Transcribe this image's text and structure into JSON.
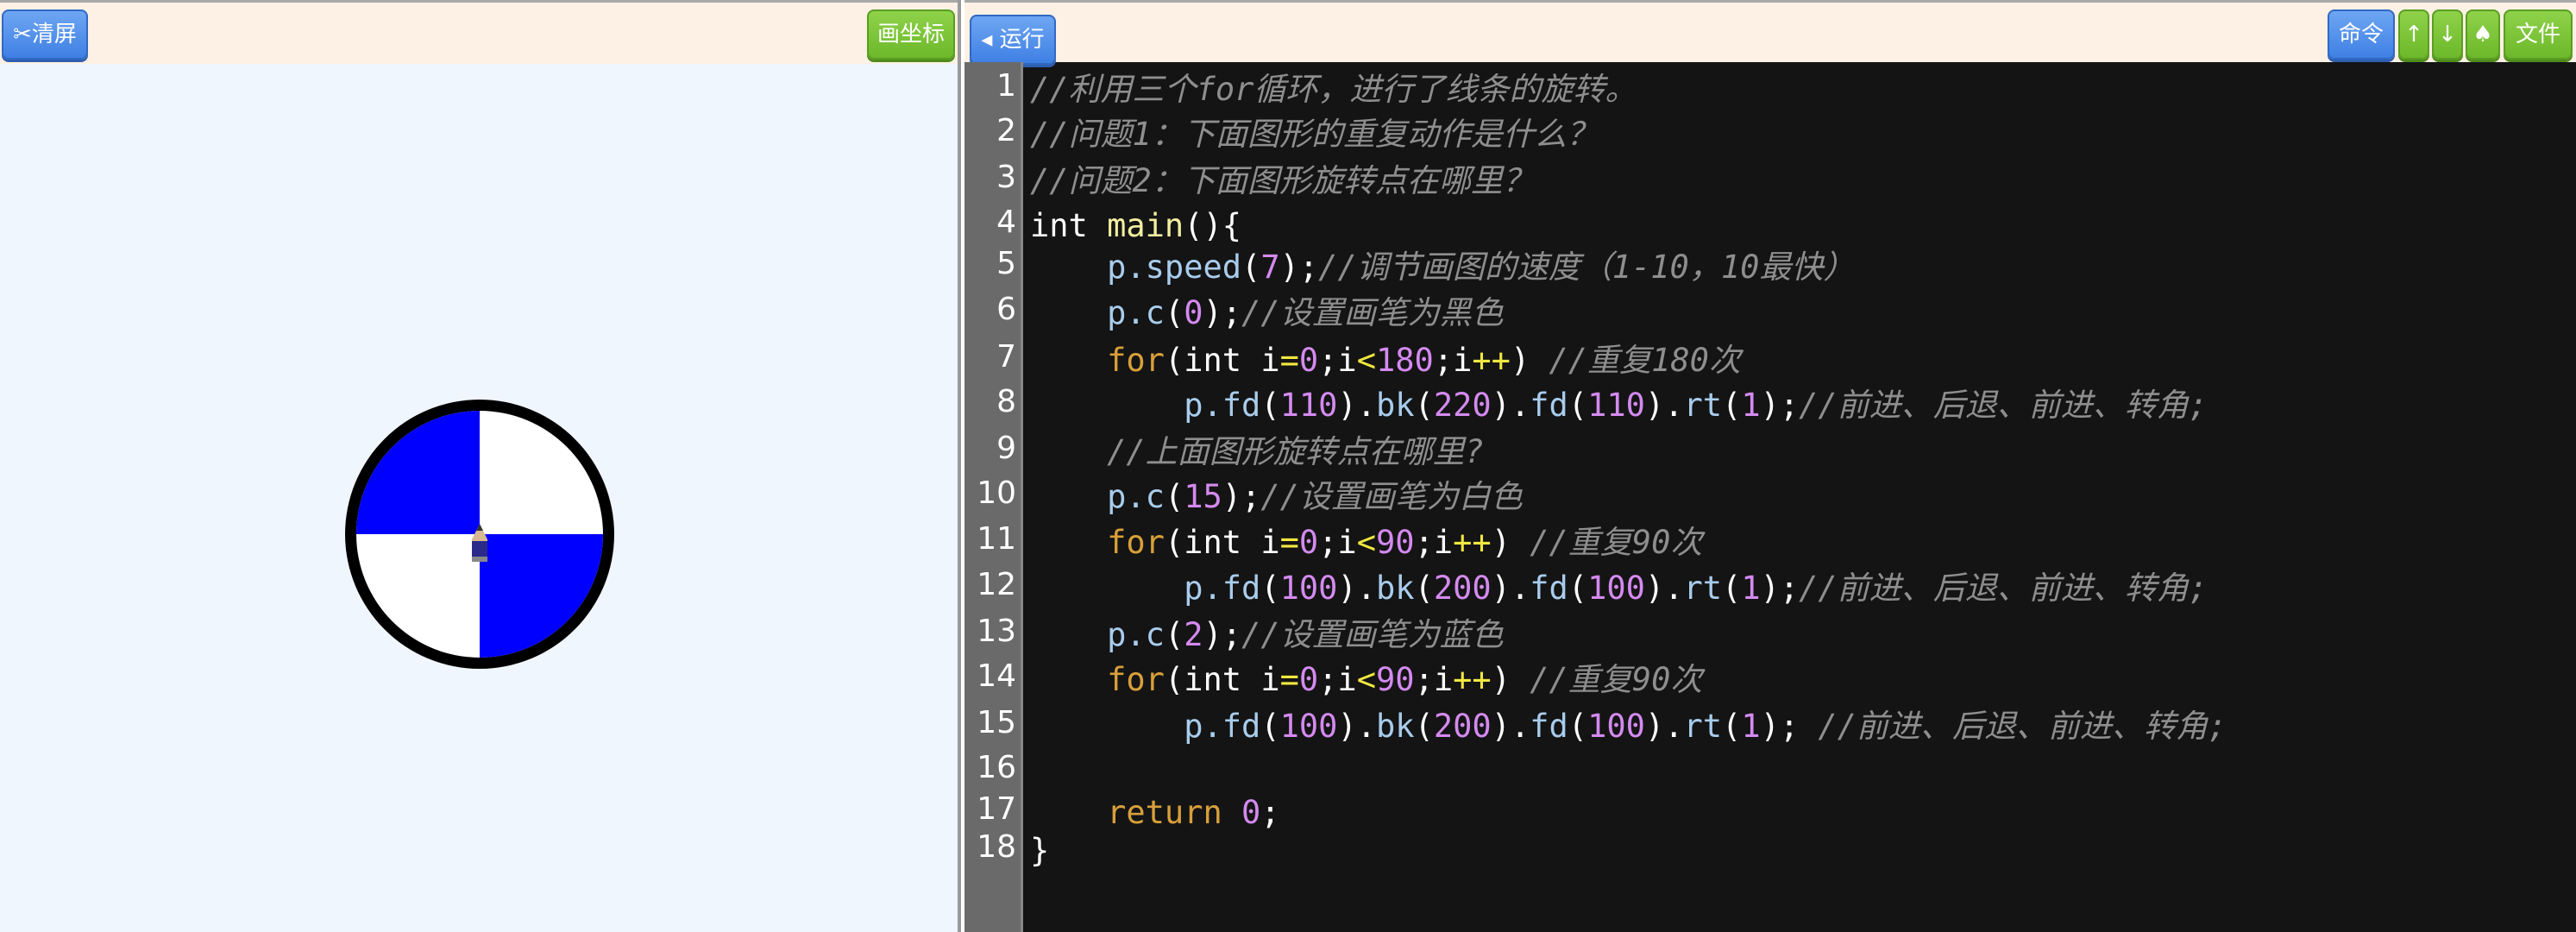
{
  "left_toolbar": {
    "clear_label": "✂清屏",
    "coord_label": "画坐标"
  },
  "right_toolbar": {
    "run_label": "◂ 运行",
    "cmd_label": "命令",
    "up_label": "↑",
    "down_label": "↓",
    "spade_label": "♠",
    "file_label": "文件"
  },
  "drawing": {
    "outer_color": "#000000",
    "fill_color": "#0000ff",
    "bg_color": "#ffffff",
    "pen_icon": "pencil-turtle-icon"
  },
  "line_numbers": [
    "1",
    "2",
    "3",
    "4",
    "5",
    "6",
    "7",
    "8",
    "9",
    "10",
    "11",
    "12",
    "13",
    "14",
    "15",
    "16",
    "17",
    "18"
  ],
  "code_lines": [
    [
      [
        "cm",
        "//利用三个for循环，进行了线条的旋转。"
      ]
    ],
    [
      [
        "cm",
        "//问题1：下面图形的重复动作是什么？"
      ]
    ],
    [
      [
        "cm",
        "//问题2：下面图形旋转点在哪里？"
      ]
    ],
    [
      [
        "pl",
        "int "
      ],
      [
        "fn",
        "main"
      ],
      [
        "pl",
        "(){"
      ]
    ],
    [
      [
        "pl",
        "    "
      ],
      [
        "mt",
        "p.speed"
      ],
      [
        "pl",
        "("
      ],
      [
        "num",
        "7"
      ],
      [
        "pl",
        ");"
      ],
      [
        "cm",
        "//调节画图的速度（1-10，10最快）"
      ]
    ],
    [
      [
        "pl",
        "    "
      ],
      [
        "mt",
        "p.c"
      ],
      [
        "pl",
        "("
      ],
      [
        "num",
        "0"
      ],
      [
        "pl",
        ");"
      ],
      [
        "cm",
        "//设置画笔为黑色"
      ]
    ],
    [
      [
        "pl",
        "    "
      ],
      [
        "kw",
        "for"
      ],
      [
        "pl",
        "(int i"
      ],
      [
        "op",
        "="
      ],
      [
        "num",
        "0"
      ],
      [
        "pl",
        ";i"
      ],
      [
        "op",
        "<"
      ],
      [
        "num",
        "180"
      ],
      [
        "pl",
        ";i"
      ],
      [
        "op",
        "++"
      ],
      [
        "pl",
        ") "
      ],
      [
        "cm",
        "//重复180次"
      ]
    ],
    [
      [
        "pl",
        "        "
      ],
      [
        "mt",
        "p.fd"
      ],
      [
        "pl",
        "("
      ],
      [
        "num",
        "110"
      ],
      [
        "pl",
        ")."
      ],
      [
        "mt",
        "bk"
      ],
      [
        "pl",
        "("
      ],
      [
        "num",
        "220"
      ],
      [
        "pl",
        ")."
      ],
      [
        "mt",
        "fd"
      ],
      [
        "pl",
        "("
      ],
      [
        "num",
        "110"
      ],
      [
        "pl",
        ")."
      ],
      [
        "mt",
        "rt"
      ],
      [
        "pl",
        "("
      ],
      [
        "num",
        "1"
      ],
      [
        "pl",
        ");"
      ],
      [
        "cm",
        "//前进、后退、前进、转角;"
      ]
    ],
    [
      [
        "pl",
        "    "
      ],
      [
        "cm",
        "//上面图形旋转点在哪里?"
      ]
    ],
    [
      [
        "pl",
        "    "
      ],
      [
        "mt",
        "p.c"
      ],
      [
        "pl",
        "("
      ],
      [
        "num",
        "15"
      ],
      [
        "pl",
        ");"
      ],
      [
        "cm",
        "//设置画笔为白色"
      ]
    ],
    [
      [
        "pl",
        "    "
      ],
      [
        "kw",
        "for"
      ],
      [
        "pl",
        "(int i"
      ],
      [
        "op",
        "="
      ],
      [
        "num",
        "0"
      ],
      [
        "pl",
        ";i"
      ],
      [
        "op",
        "<"
      ],
      [
        "num",
        "90"
      ],
      [
        "pl",
        ";i"
      ],
      [
        "op",
        "++"
      ],
      [
        "pl",
        ") "
      ],
      [
        "cm",
        "//重复90次"
      ]
    ],
    [
      [
        "pl",
        "        "
      ],
      [
        "mt",
        "p.fd"
      ],
      [
        "pl",
        "("
      ],
      [
        "num",
        "100"
      ],
      [
        "pl",
        ")."
      ],
      [
        "mt",
        "bk"
      ],
      [
        "pl",
        "("
      ],
      [
        "num",
        "200"
      ],
      [
        "pl",
        ")."
      ],
      [
        "mt",
        "fd"
      ],
      [
        "pl",
        "("
      ],
      [
        "num",
        "100"
      ],
      [
        "pl",
        ")."
      ],
      [
        "mt",
        "rt"
      ],
      [
        "pl",
        "("
      ],
      [
        "num",
        "1"
      ],
      [
        "pl",
        ");"
      ],
      [
        "cm",
        "//前进、后退、前进、转角;"
      ]
    ],
    [
      [
        "pl",
        "    "
      ],
      [
        "mt",
        "p.c"
      ],
      [
        "pl",
        "("
      ],
      [
        "num",
        "2"
      ],
      [
        "pl",
        ");"
      ],
      [
        "cm",
        "//设置画笔为蓝色"
      ]
    ],
    [
      [
        "pl",
        "    "
      ],
      [
        "kw",
        "for"
      ],
      [
        "pl",
        "(int i"
      ],
      [
        "op",
        "="
      ],
      [
        "num",
        "0"
      ],
      [
        "pl",
        ";i"
      ],
      [
        "op",
        "<"
      ],
      [
        "num",
        "90"
      ],
      [
        "pl",
        ";i"
      ],
      [
        "op",
        "++"
      ],
      [
        "pl",
        ") "
      ],
      [
        "cm",
        "//重复90次"
      ]
    ],
    [
      [
        "pl",
        "        "
      ],
      [
        "mt",
        "p.fd"
      ],
      [
        "pl",
        "("
      ],
      [
        "num",
        "100"
      ],
      [
        "pl",
        ")."
      ],
      [
        "mt",
        "bk"
      ],
      [
        "pl",
        "("
      ],
      [
        "num",
        "200"
      ],
      [
        "pl",
        ")."
      ],
      [
        "mt",
        "fd"
      ],
      [
        "pl",
        "("
      ],
      [
        "num",
        "100"
      ],
      [
        "pl",
        ")."
      ],
      [
        "mt",
        "rt"
      ],
      [
        "pl",
        "("
      ],
      [
        "num",
        "1"
      ],
      [
        "pl",
        "); "
      ],
      [
        "cm",
        "//前进、后退、前进、转角;"
      ]
    ],
    [
      [
        "pl",
        ""
      ]
    ],
    [
      [
        "pl",
        "    "
      ],
      [
        "kw",
        "return"
      ],
      [
        "pl",
        " "
      ],
      [
        "num",
        "0"
      ],
      [
        "pl",
        ";"
      ]
    ],
    [
      [
        "pl",
        "}"
      ]
    ]
  ]
}
